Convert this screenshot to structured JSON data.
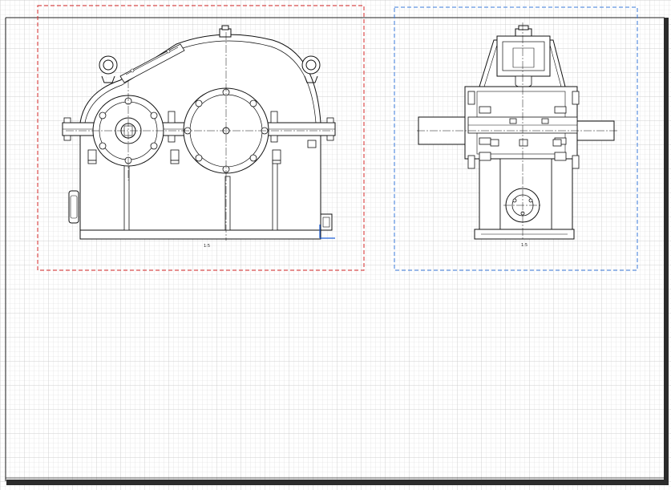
{
  "sheet": {
    "grid_color": "#d4d4d4",
    "border_color": "#1a1a1a",
    "background": "#ffffff"
  },
  "views": {
    "front": {
      "frame_color": "#d62828",
      "scale_label": "1:5"
    },
    "side": {
      "frame_color": "#3a78d8",
      "scale_label": "1:5"
    }
  },
  "icons": {
    "ucs": "ucs-axis-icon"
  },
  "colors": {
    "line": "#111111",
    "ucs": "#1f5fd6"
  }
}
